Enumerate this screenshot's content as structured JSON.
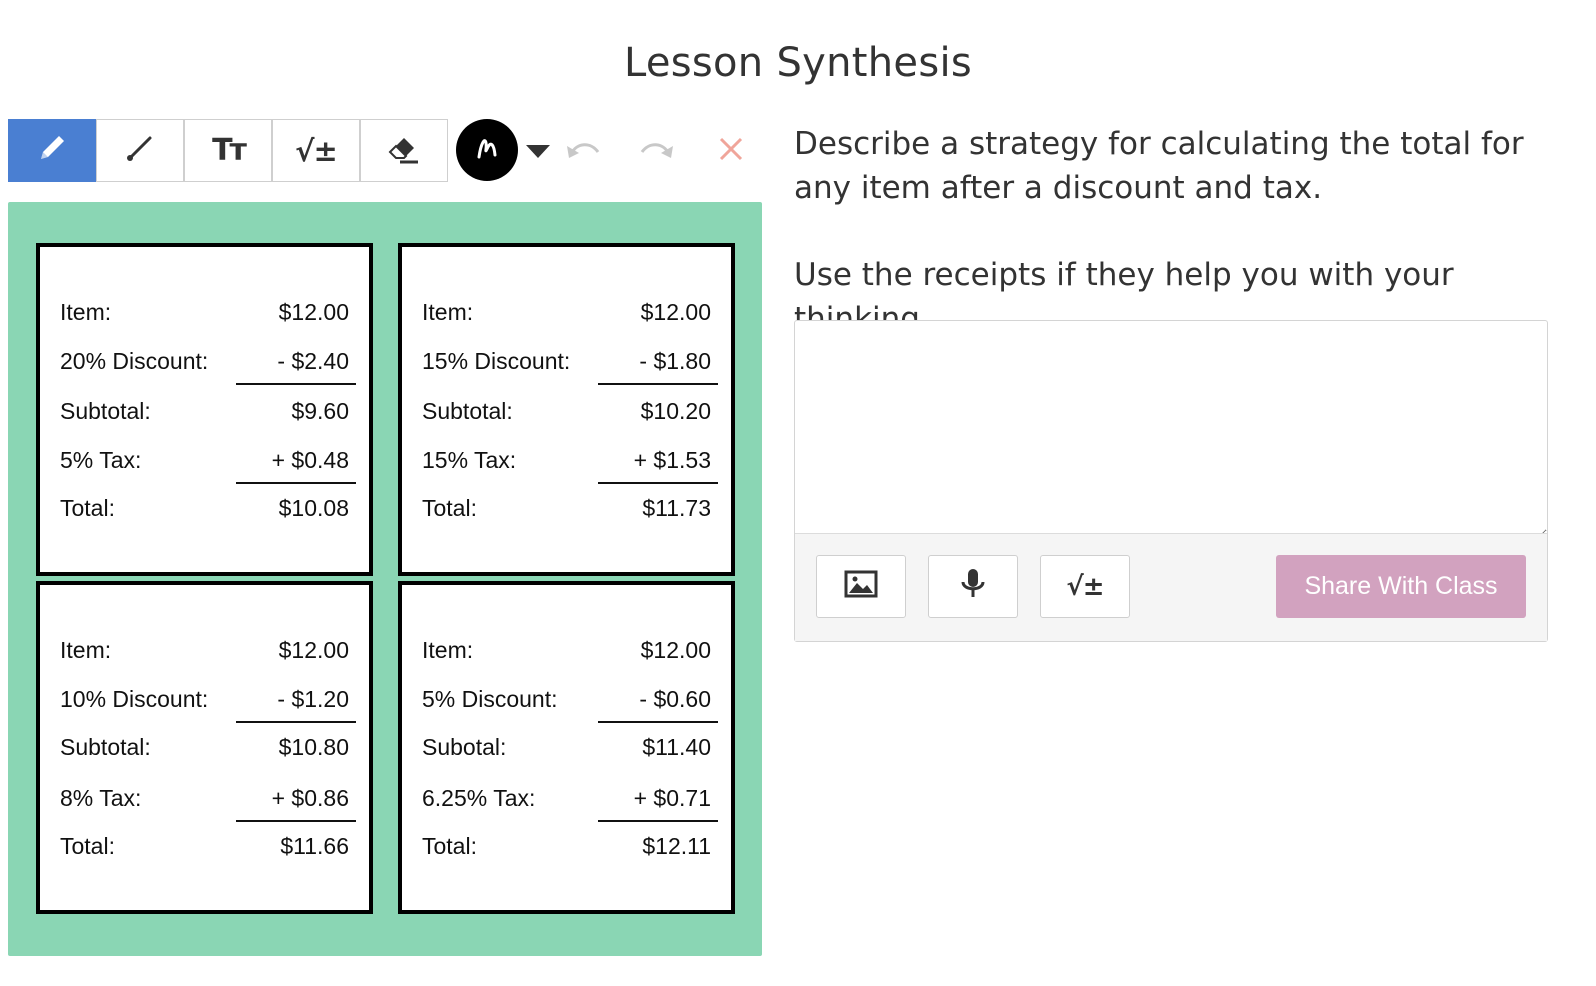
{
  "page": {
    "title": "Lesson Synthesis"
  },
  "toolbar": {
    "tools": [
      {
        "name": "draw",
        "icon": "pencil-icon",
        "active": true
      },
      {
        "name": "line",
        "icon": "line-icon",
        "active": false
      },
      {
        "name": "text",
        "icon": "text-size-icon",
        "glyph": "Tт",
        "active": false
      },
      {
        "name": "math",
        "icon": "math-icon",
        "glyph": "√±",
        "active": false
      },
      {
        "name": "eraser",
        "icon": "eraser-icon",
        "active": false
      }
    ],
    "pen_color": "#000000",
    "accent": "#4a7fd2"
  },
  "canvas": {
    "background": "#8ad6b4",
    "receipts": [
      {
        "rows": [
          {
            "label": "Item:",
            "value": "$12.00"
          },
          {
            "label": "20% Discount:",
            "value": "- $2.40"
          },
          {
            "label": "Subtotal:",
            "value": "$9.60"
          },
          {
            "label": "5% Tax:",
            "value": "+ $0.48"
          },
          {
            "label": "Total:",
            "value": "$10.08"
          }
        ]
      },
      {
        "rows": [
          {
            "label": "Item:",
            "value": "$12.00"
          },
          {
            "label": "15% Discount:",
            "value": "- $1.80"
          },
          {
            "label": "Subtotal:",
            "value": "$10.20"
          },
          {
            "label": "15% Tax:",
            "value": "+ $1.53"
          },
          {
            "label": "Total:",
            "value": "$11.73"
          }
        ]
      },
      {
        "rows": [
          {
            "label": "Item:",
            "value": "$12.00"
          },
          {
            "label": "10% Discount:",
            "value": "- $1.20"
          },
          {
            "label": "Subtotal:",
            "value": "$10.80"
          },
          {
            "label": "8% Tax:",
            "value": "+ $0.86"
          },
          {
            "label": "Total:",
            "value": "$11.66"
          }
        ]
      },
      {
        "rows": [
          {
            "label": "Item:",
            "value": "$12.00"
          },
          {
            "label": "5% Discount:",
            "value": "- $0.60"
          },
          {
            "label": "Subotal:",
            "value": "$11.40"
          },
          {
            "label": "6.25% Tax:",
            "value": "+ $0.71"
          },
          {
            "label": "Total:",
            "value": "$12.11"
          }
        ]
      }
    ]
  },
  "prompt": {
    "question": "Describe a strategy for calculating the total for any item after a discount and tax.",
    "hint": "Use the receipts if they help you with your thinking."
  },
  "answer": {
    "value": "",
    "footer_icons": [
      "image-icon",
      "microphone-icon",
      "math-icon"
    ],
    "math_glyph": "√±",
    "share_label": "Share With Class",
    "share_color": "#d2a2bf"
  }
}
